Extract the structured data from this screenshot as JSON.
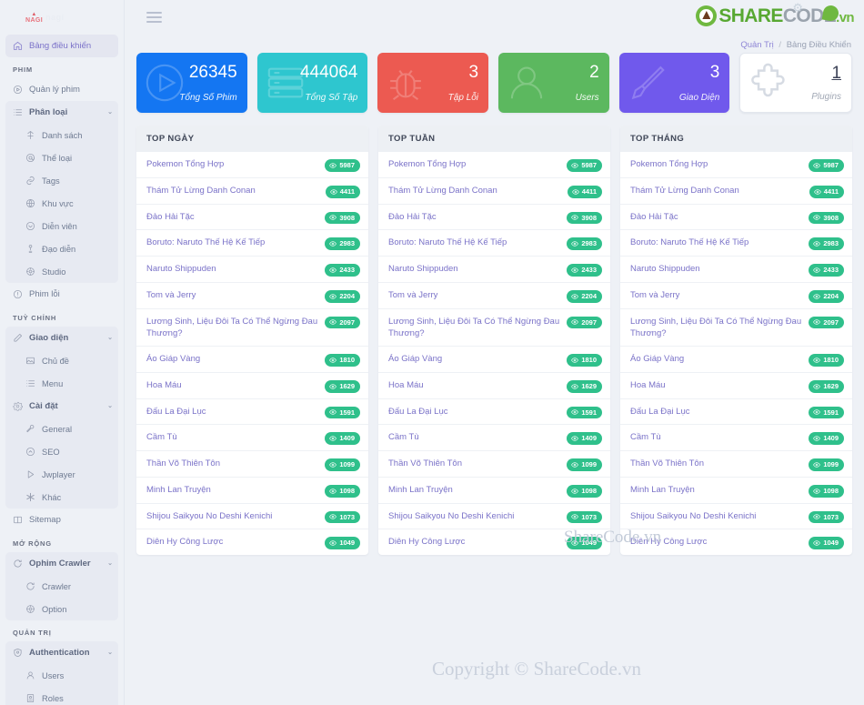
{
  "brand": {
    "mark": "NAGI",
    "name": "nagi"
  },
  "topbar": {
    "menu_toggle": "hamburger-menu"
  },
  "watermark": {
    "logo_part1": "SHARE",
    "logo_part2": "CODE",
    "logo_part3": ".vn",
    "center_text": "ShareCode.vn",
    "footer_text": "Copyright © ShareCode.vn"
  },
  "breadcrumb": {
    "parent": "Quản Trị",
    "separator": "/",
    "current": "Bảng Điều Khiển"
  },
  "sidebar": {
    "dashboard": {
      "label": "Bảng điều khiển",
      "icon": "home-icon"
    },
    "sections": [
      {
        "title": "PHIM",
        "items": [
          {
            "label": "Quản lý phim",
            "icon": "play-circle-icon",
            "level": "top",
            "caret": false
          },
          {
            "label": "Phân loại",
            "icon": "list-icon",
            "level": "parent",
            "caret": true
          },
          {
            "label": "Danh sách",
            "icon": "film-icon",
            "level": "sub",
            "caret": false
          },
          {
            "label": "Thể loại",
            "icon": "at-icon",
            "level": "sub",
            "caret": false
          },
          {
            "label": "Tags",
            "icon": "link-icon",
            "level": "sub",
            "caret": false
          },
          {
            "label": "Khu vực",
            "icon": "globe-icon",
            "level": "sub",
            "caret": false
          },
          {
            "label": "Diễn viên",
            "icon": "user-circle-icon",
            "level": "sub",
            "caret": false
          },
          {
            "label": "Đạo diễn",
            "icon": "director-icon",
            "level": "sub",
            "caret": false
          },
          {
            "label": "Studio",
            "icon": "gear-circle-icon",
            "level": "sub",
            "caret": false
          },
          {
            "label": "Phim lỗi",
            "icon": "alert-circle-icon",
            "level": "top",
            "caret": false
          }
        ]
      },
      {
        "title": "TUỲ CHỈNH",
        "items": [
          {
            "label": "Giao diện",
            "icon": "pencil-icon",
            "level": "parent",
            "caret": true
          },
          {
            "label": "Chủ đề",
            "icon": "image-icon",
            "level": "sub",
            "caret": false
          },
          {
            "label": "Menu",
            "icon": "menu-list-icon",
            "level": "sub",
            "caret": false
          },
          {
            "label": "Cài đặt",
            "icon": "gear-icon",
            "level": "parent",
            "caret": true
          },
          {
            "label": "General",
            "icon": "wrench-icon",
            "level": "sub",
            "caret": false
          },
          {
            "label": "SEO",
            "icon": "chevron-circle-icon",
            "level": "sub",
            "caret": false
          },
          {
            "label": "Jwplayer",
            "icon": "play-icon",
            "level": "sub",
            "caret": false
          },
          {
            "label": "Khác",
            "icon": "asterisk-icon",
            "level": "sub",
            "caret": false
          },
          {
            "label": "Sitemap",
            "icon": "book-icon",
            "level": "top",
            "caret": false
          }
        ]
      },
      {
        "title": "MỞ RỘNG",
        "items": [
          {
            "label": "Ophim Crawler",
            "icon": "refresh-icon",
            "level": "parent",
            "caret": true
          },
          {
            "label": "Crawler",
            "icon": "refresh-icon",
            "level": "sub",
            "caret": false
          },
          {
            "label": "Option",
            "icon": "gear-circle-icon",
            "level": "sub",
            "caret": false
          }
        ]
      },
      {
        "title": "QUẢN TRỊ",
        "items": [
          {
            "label": "Authentication",
            "icon": "shield-icon",
            "level": "parent",
            "caret": true
          },
          {
            "label": "Users",
            "icon": "user-icon",
            "level": "sub",
            "caret": false
          },
          {
            "label": "Roles",
            "icon": "badge-icon",
            "level": "sub",
            "caret": false
          }
        ]
      }
    ]
  },
  "stat_cards": [
    {
      "value": "26345",
      "label": "Tổng Số Phim",
      "color": "#1476f2",
      "icon": "play-circle-icon"
    },
    {
      "value": "444064",
      "label": "Tổng Số Tập",
      "color": "#2ec6cf",
      "icon": "server-icon"
    },
    {
      "value": "3",
      "label": "Tập Lỗi",
      "color": "#ec5a51",
      "icon": "bug-icon"
    },
    {
      "value": "2",
      "label": "Users",
      "color": "#5cb85f",
      "icon": "user-icon"
    },
    {
      "value": "3",
      "label": "Giao Diện",
      "color": "#7059ec",
      "icon": "brush-icon"
    },
    {
      "value": "1",
      "label": "Plugins",
      "color": "#ffffff",
      "icon": "puzzle-icon"
    }
  ],
  "panels": [
    {
      "title": "TOP NGÀY",
      "rows": [
        {
          "title": "Pokemon Tổng Hợp",
          "views": "5987"
        },
        {
          "title": "Thám Tử Lừng Danh Conan",
          "views": "4411"
        },
        {
          "title": "Đảo Hải Tặc",
          "views": "3908"
        },
        {
          "title": "Boruto: Naruto Thế Hệ Kế Tiếp",
          "views": "2983"
        },
        {
          "title": "Naruto Shippuden",
          "views": "2433"
        },
        {
          "title": "Tom và Jerry",
          "views": "2204"
        },
        {
          "title": "Lương Sinh, Liệu Đôi Ta Có Thể Ngừng Đau Thương?",
          "views": "2097"
        },
        {
          "title": "Áo Giáp Vàng",
          "views": "1810"
        },
        {
          "title": "Hoa Máu",
          "views": "1629"
        },
        {
          "title": "Đấu La Đại Lục",
          "views": "1591"
        },
        {
          "title": "Cầm Tù",
          "views": "1409"
        },
        {
          "title": "Thần Võ Thiên Tôn",
          "views": "1099"
        },
        {
          "title": "Minh Lan Truyện",
          "views": "1098"
        },
        {
          "title": "Shijou Saikyou No Deshi Kenichi",
          "views": "1073"
        },
        {
          "title": "Diên Hy Công Lược",
          "views": "1049"
        }
      ]
    },
    {
      "title": "TOP TUẦN",
      "rows": [
        {
          "title": "Pokemon Tổng Hợp",
          "views": "5987"
        },
        {
          "title": "Thám Tử Lừng Danh Conan",
          "views": "4411"
        },
        {
          "title": "Đảo Hải Tặc",
          "views": "3908"
        },
        {
          "title": "Boruto: Naruto Thế Hệ Kế Tiếp",
          "views": "2983"
        },
        {
          "title": "Naruto Shippuden",
          "views": "2433"
        },
        {
          "title": "Tom và Jerry",
          "views": "2204"
        },
        {
          "title": "Lương Sinh, Liệu Đôi Ta Có Thể Ngừng Đau Thương?",
          "views": "2097"
        },
        {
          "title": "Áo Giáp Vàng",
          "views": "1810"
        },
        {
          "title": "Hoa Máu",
          "views": "1629"
        },
        {
          "title": "Đấu La Đại Lục",
          "views": "1591"
        },
        {
          "title": "Cầm Tù",
          "views": "1409"
        },
        {
          "title": "Thần Võ Thiên Tôn",
          "views": "1099"
        },
        {
          "title": "Minh Lan Truyện",
          "views": "1098"
        },
        {
          "title": "Shijou Saikyou No Deshi Kenichi",
          "views": "1073"
        },
        {
          "title": "Diên Hy Công Lược",
          "views": "1049"
        }
      ]
    },
    {
      "title": "TOP THÁNG",
      "rows": [
        {
          "title": "Pokemon Tổng Hợp",
          "views": "5987"
        },
        {
          "title": "Thám Tử Lừng Danh Conan",
          "views": "4411"
        },
        {
          "title": "Đảo Hải Tặc",
          "views": "3908"
        },
        {
          "title": "Boruto: Naruto Thế Hệ Kế Tiếp",
          "views": "2983"
        },
        {
          "title": "Naruto Shippuden",
          "views": "2433"
        },
        {
          "title": "Tom và Jerry",
          "views": "2204"
        },
        {
          "title": "Lương Sinh, Liệu Đôi Ta Có Thể Ngừng Đau Thương?",
          "views": "2097"
        },
        {
          "title": "Áo Giáp Vàng",
          "views": "1810"
        },
        {
          "title": "Hoa Máu",
          "views": "1629"
        },
        {
          "title": "Đấu La Đại Lục",
          "views": "1591"
        },
        {
          "title": "Cầm Tù",
          "views": "1409"
        },
        {
          "title": "Thần Võ Thiên Tôn",
          "views": "1099"
        },
        {
          "title": "Minh Lan Truyện",
          "views": "1098"
        },
        {
          "title": "Shijou Saikyou No Deshi Kenichi",
          "views": "1073"
        },
        {
          "title": "Diên Hy Công Lược",
          "views": "1049"
        }
      ]
    }
  ]
}
